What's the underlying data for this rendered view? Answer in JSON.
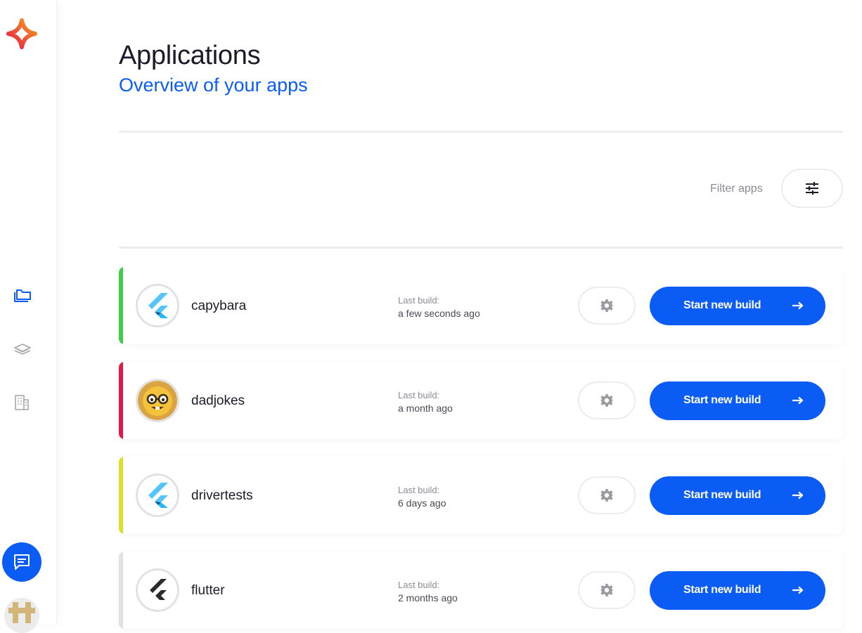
{
  "sidebar": {
    "logo_icon": "sparkle-logo-icon",
    "nav": [
      {
        "name": "applications",
        "icon": "folders-icon",
        "active": true
      },
      {
        "name": "layers",
        "icon": "layers-icon",
        "active": false
      },
      {
        "name": "organization",
        "icon": "building-icon",
        "active": false
      }
    ],
    "chat_icon": "chat-icon",
    "avatar": "user-avatar"
  },
  "header": {
    "title": "Applications",
    "subtitle": "Overview of your apps"
  },
  "filter": {
    "label": "Filter apps",
    "icon": "sliders-icon"
  },
  "colors": {
    "primary": "#0a5cf5",
    "green": "#3ecf4a",
    "red": "#e8174a",
    "yellow": "#dede2a",
    "gray": "#e2e2e6"
  },
  "apps": [
    {
      "name": "capybara",
      "build_label": "Last build:",
      "build_time": "a few seconds ago",
      "accent": "#3ecf4a",
      "icon": "flutter-icon",
      "start_label": "Start new build"
    },
    {
      "name": "dadjokes",
      "build_label": "Last build:",
      "build_time": "a month ago",
      "accent": "#e8174a",
      "icon": "nerd-face-icon",
      "start_label": "Start new build"
    },
    {
      "name": "drivertests",
      "build_label": "Last build:",
      "build_time": "6 days ago",
      "accent": "#dede2a",
      "icon": "flutter-icon",
      "start_label": "Start new build"
    },
    {
      "name": "flutter",
      "build_label": "Last build:",
      "build_time": "2 months ago",
      "accent": "#e2e2e6",
      "icon": "flutter-dark-icon",
      "start_label": "Start new build"
    }
  ]
}
